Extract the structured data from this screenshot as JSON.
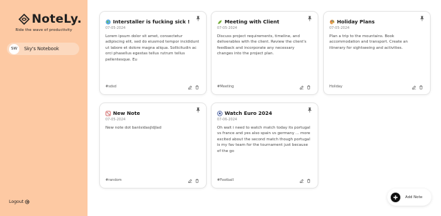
{
  "sidebar": {
    "brand": "NoteLy.",
    "tagline": "Ride the wave of productivity",
    "profile": {
      "initials": "SW",
      "name": "Sky's Notebook"
    },
    "logout_label": "Logout"
  },
  "notes": [
    {
      "title": "Interstaller is fucking sick !",
      "icon": "globe-emoji",
      "date": "07-05-2024",
      "body": "Lorem ipsum dolor sit amet, consectetur adipiscing elit, sed do eiusmod tempor incididunt ut labore et dolore magna aliqua. Sollicitudin ac orci phasellus egestas tellus rutrum tellus pellentesque. Eu",
      "tag": "#sdsd"
    },
    {
      "title": "Meeting with Client",
      "icon": "leaf-emoji",
      "date": "07-05-2024",
      "body": "Discuss project requirements, timeline, and deliverables with the client. Review the client's feedback and incorporate any necessary changes into the project plan.",
      "tag": "#Meeting"
    },
    {
      "title": "Holiday Plans",
      "icon": "palette-emoji",
      "date": "07-05-2024",
      "body": "Plan a trip to the mountains. Book accommodation and transport. Create an itinerary for sightseeing and activities.",
      "tag": "Holiday"
    },
    {
      "title": "New Note",
      "icon": "dice-emoji",
      "date": "07-05-2024",
      "body": "New note dot banlsidasjldjlad",
      "tag": "#random"
    },
    {
      "title": "Watch Euro 2024",
      "icon": "soccer-ball-emoji",
      "date": "07-06-2024",
      "body": "Oh wait i need to watch match today its portugal vs france and yes also spain vs germany ... more excited about the second match though portugal is my fav team for the tournament just because of the go",
      "tag": "#Football"
    }
  ],
  "add_note_label": "Add Note",
  "colors": {
    "sidebar": "#fdc9a3",
    "profile": "#fcd9bf",
    "accent": "#111111"
  }
}
